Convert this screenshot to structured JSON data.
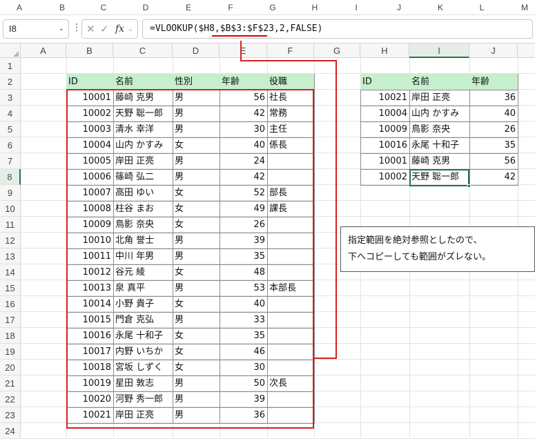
{
  "outer_columns": [
    "A",
    "B",
    "C",
    "D",
    "E",
    "F",
    "G",
    "H",
    "I",
    "J",
    "K",
    "L",
    "M"
  ],
  "formula_bar": {
    "name_box": "I8",
    "fx_label": "fx",
    "formula": "=VLOOKUP($H8,$B$3:$F$23,2,FALSE)"
  },
  "grid": {
    "columns": [
      "A",
      "B",
      "C",
      "D",
      "E",
      "F",
      "G",
      "H",
      "I",
      "J"
    ],
    "selected_column": "I",
    "rows": [
      "1",
      "2",
      "3",
      "4",
      "5",
      "6",
      "7",
      "8",
      "9",
      "10",
      "11",
      "12",
      "13",
      "14",
      "15",
      "16",
      "17",
      "18",
      "19",
      "20",
      "21",
      "22",
      "23",
      "24"
    ],
    "selected_row": "8"
  },
  "main_table": {
    "headers": [
      "ID",
      "名前",
      "性別",
      "年齢",
      "役職"
    ],
    "rows": [
      [
        "10001",
        "藤崎 克男",
        "男",
        "56",
        "社長"
      ],
      [
        "10002",
        "天野 聡一郎",
        "男",
        "42",
        "常務"
      ],
      [
        "10003",
        "清水 幸洋",
        "男",
        "30",
        "主任"
      ],
      [
        "10004",
        "山内 かすみ",
        "女",
        "40",
        "係長"
      ],
      [
        "10005",
        "岸田 正亮",
        "男",
        "24",
        ""
      ],
      [
        "10006",
        "篠崎 弘二",
        "男",
        "42",
        ""
      ],
      [
        "10007",
        "高田 ゆい",
        "女",
        "52",
        "部長"
      ],
      [
        "10008",
        "柱谷 まお",
        "女",
        "49",
        "課長"
      ],
      [
        "10009",
        "鳥影 奈央",
        "女",
        "26",
        ""
      ],
      [
        "10010",
        "北角 誉士",
        "男",
        "39",
        ""
      ],
      [
        "10011",
        "中川 年男",
        "男",
        "35",
        ""
      ],
      [
        "10012",
        "谷元 綾",
        "女",
        "48",
        ""
      ],
      [
        "10013",
        "泉 真平",
        "男",
        "53",
        "本部長"
      ],
      [
        "10014",
        "小野 貴子",
        "女",
        "40",
        ""
      ],
      [
        "10015",
        "門倉 克弘",
        "男",
        "33",
        ""
      ],
      [
        "10016",
        "永尾 十和子",
        "女",
        "35",
        ""
      ],
      [
        "10017",
        "内野 いちか",
        "女",
        "46",
        ""
      ],
      [
        "10018",
        "宮坂 しずく",
        "女",
        "30",
        ""
      ],
      [
        "10019",
        "星田 敦志",
        "男",
        "50",
        "次長"
      ],
      [
        "10020",
        "河野 秀一郎",
        "男",
        "39",
        ""
      ],
      [
        "10021",
        "岸田 正亮",
        "男",
        "36",
        ""
      ]
    ]
  },
  "lookup_table": {
    "headers": [
      "ID",
      "名前",
      "年齢"
    ],
    "rows": [
      [
        "10021",
        "岸田 正亮",
        "36"
      ],
      [
        "10004",
        "山内 かすみ",
        "40"
      ],
      [
        "10009",
        "鳥影 奈央",
        "26"
      ],
      [
        "10016",
        "永尾 十和子",
        "35"
      ],
      [
        "10001",
        "藤崎 克男",
        "56"
      ],
      [
        "10002",
        "天野 聡一郎",
        "42"
      ]
    ]
  },
  "note": {
    "line1": "指定範囲を絶対参照としたので、",
    "line2": "下へコピーしても範囲がズレない。"
  },
  "colors": {
    "header_fill": "#c6efce",
    "highlight_red": "#d42020",
    "selection_green": "#217346"
  }
}
